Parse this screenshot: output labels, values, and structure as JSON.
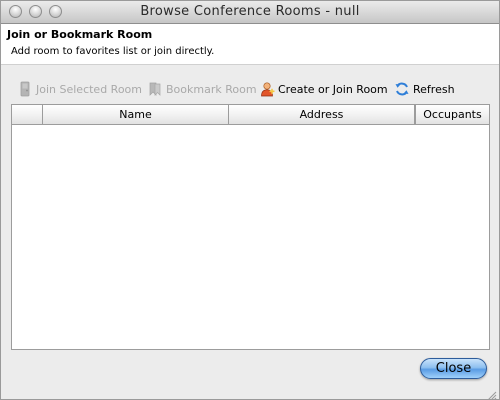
{
  "window": {
    "title": "Browse Conference Rooms - null"
  },
  "header": {
    "title": "Join or Bookmark Room",
    "description": "Add room to favorites list or join directly."
  },
  "toolbar": {
    "join_label": "Join Selected Room",
    "bookmark_label": "Bookmark Room",
    "create_label": "Create or Join Room",
    "refresh_label": "Refresh",
    "icons": {
      "join": "door-icon",
      "bookmark": "bookmark-icon",
      "create": "user-add-icon",
      "refresh": "refresh-icon"
    }
  },
  "table": {
    "columns": [
      "",
      "Name",
      "Address",
      "Occupants"
    ],
    "rows": []
  },
  "footer": {
    "close_label": "Close"
  },
  "colors": {
    "close_button": "#5a9ce4",
    "disabled_text": "#a9a9a9"
  }
}
